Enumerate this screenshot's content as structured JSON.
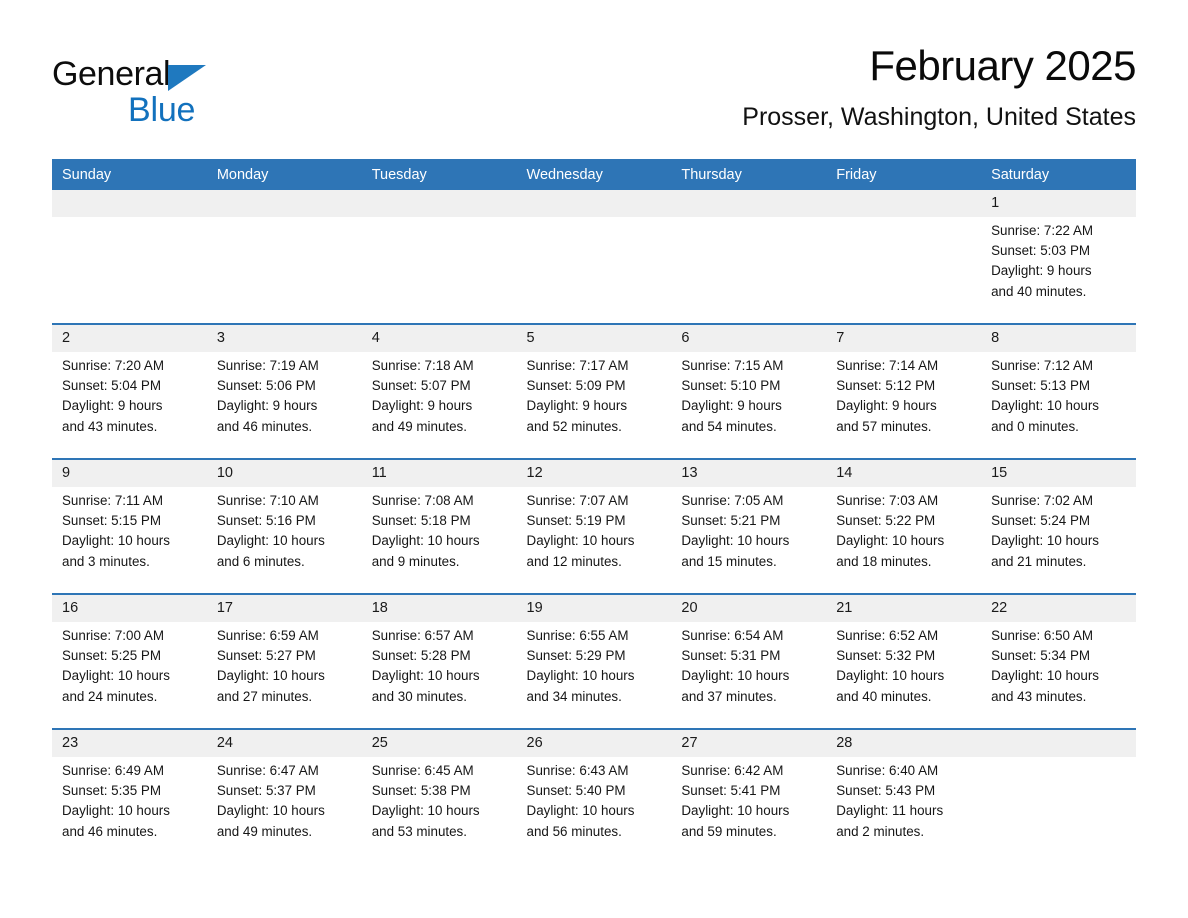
{
  "brand": {
    "name_dark": "General",
    "name_blue": "Blue",
    "accent_color": "#1f79bf"
  },
  "header": {
    "month_title": "February 2025",
    "location": "Prosser, Washington, United States",
    "header_bg_color": "#2e75b6",
    "daynum_bg_color": "#f0f0f0"
  },
  "weekday_headers": [
    "Sunday",
    "Monday",
    "Tuesday",
    "Wednesday",
    "Thursday",
    "Friday",
    "Saturday"
  ],
  "weeks": [
    [
      {
        "day": "",
        "empty": true,
        "sunrise": "",
        "sunset": "",
        "daylight1": "",
        "daylight2": ""
      },
      {
        "day": "",
        "empty": true,
        "sunrise": "",
        "sunset": "",
        "daylight1": "",
        "daylight2": ""
      },
      {
        "day": "",
        "empty": true,
        "sunrise": "",
        "sunset": "",
        "daylight1": "",
        "daylight2": ""
      },
      {
        "day": "",
        "empty": true,
        "sunrise": "",
        "sunset": "",
        "daylight1": "",
        "daylight2": ""
      },
      {
        "day": "",
        "empty": true,
        "sunrise": "",
        "sunset": "",
        "daylight1": "",
        "daylight2": ""
      },
      {
        "day": "",
        "empty": true,
        "sunrise": "",
        "sunset": "",
        "daylight1": "",
        "daylight2": ""
      },
      {
        "day": "1",
        "empty": false,
        "sunrise": "Sunrise: 7:22 AM",
        "sunset": "Sunset: 5:03 PM",
        "daylight1": "Daylight: 9 hours",
        "daylight2": "and 40 minutes."
      }
    ],
    [
      {
        "day": "2",
        "empty": false,
        "sunrise": "Sunrise: 7:20 AM",
        "sunset": "Sunset: 5:04 PM",
        "daylight1": "Daylight: 9 hours",
        "daylight2": "and 43 minutes."
      },
      {
        "day": "3",
        "empty": false,
        "sunrise": "Sunrise: 7:19 AM",
        "sunset": "Sunset: 5:06 PM",
        "daylight1": "Daylight: 9 hours",
        "daylight2": "and 46 minutes."
      },
      {
        "day": "4",
        "empty": false,
        "sunrise": "Sunrise: 7:18 AM",
        "sunset": "Sunset: 5:07 PM",
        "daylight1": "Daylight: 9 hours",
        "daylight2": "and 49 minutes."
      },
      {
        "day": "5",
        "empty": false,
        "sunrise": "Sunrise: 7:17 AM",
        "sunset": "Sunset: 5:09 PM",
        "daylight1": "Daylight: 9 hours",
        "daylight2": "and 52 minutes."
      },
      {
        "day": "6",
        "empty": false,
        "sunrise": "Sunrise: 7:15 AM",
        "sunset": "Sunset: 5:10 PM",
        "daylight1": "Daylight: 9 hours",
        "daylight2": "and 54 minutes."
      },
      {
        "day": "7",
        "empty": false,
        "sunrise": "Sunrise: 7:14 AM",
        "sunset": "Sunset: 5:12 PM",
        "daylight1": "Daylight: 9 hours",
        "daylight2": "and 57 minutes."
      },
      {
        "day": "8",
        "empty": false,
        "sunrise": "Sunrise: 7:12 AM",
        "sunset": "Sunset: 5:13 PM",
        "daylight1": "Daylight: 10 hours",
        "daylight2": "and 0 minutes."
      }
    ],
    [
      {
        "day": "9",
        "empty": false,
        "sunrise": "Sunrise: 7:11 AM",
        "sunset": "Sunset: 5:15 PM",
        "daylight1": "Daylight: 10 hours",
        "daylight2": "and 3 minutes."
      },
      {
        "day": "10",
        "empty": false,
        "sunrise": "Sunrise: 7:10 AM",
        "sunset": "Sunset: 5:16 PM",
        "daylight1": "Daylight: 10 hours",
        "daylight2": "and 6 minutes."
      },
      {
        "day": "11",
        "empty": false,
        "sunrise": "Sunrise: 7:08 AM",
        "sunset": "Sunset: 5:18 PM",
        "daylight1": "Daylight: 10 hours",
        "daylight2": "and 9 minutes."
      },
      {
        "day": "12",
        "empty": false,
        "sunrise": "Sunrise: 7:07 AM",
        "sunset": "Sunset: 5:19 PM",
        "daylight1": "Daylight: 10 hours",
        "daylight2": "and 12 minutes."
      },
      {
        "day": "13",
        "empty": false,
        "sunrise": "Sunrise: 7:05 AM",
        "sunset": "Sunset: 5:21 PM",
        "daylight1": "Daylight: 10 hours",
        "daylight2": "and 15 minutes."
      },
      {
        "day": "14",
        "empty": false,
        "sunrise": "Sunrise: 7:03 AM",
        "sunset": "Sunset: 5:22 PM",
        "daylight1": "Daylight: 10 hours",
        "daylight2": "and 18 minutes."
      },
      {
        "day": "15",
        "empty": false,
        "sunrise": "Sunrise: 7:02 AM",
        "sunset": "Sunset: 5:24 PM",
        "daylight1": "Daylight: 10 hours",
        "daylight2": "and 21 minutes."
      }
    ],
    [
      {
        "day": "16",
        "empty": false,
        "sunrise": "Sunrise: 7:00 AM",
        "sunset": "Sunset: 5:25 PM",
        "daylight1": "Daylight: 10 hours",
        "daylight2": "and 24 minutes."
      },
      {
        "day": "17",
        "empty": false,
        "sunrise": "Sunrise: 6:59 AM",
        "sunset": "Sunset: 5:27 PM",
        "daylight1": "Daylight: 10 hours",
        "daylight2": "and 27 minutes."
      },
      {
        "day": "18",
        "empty": false,
        "sunrise": "Sunrise: 6:57 AM",
        "sunset": "Sunset: 5:28 PM",
        "daylight1": "Daylight: 10 hours",
        "daylight2": "and 30 minutes."
      },
      {
        "day": "19",
        "empty": false,
        "sunrise": "Sunrise: 6:55 AM",
        "sunset": "Sunset: 5:29 PM",
        "daylight1": "Daylight: 10 hours",
        "daylight2": "and 34 minutes."
      },
      {
        "day": "20",
        "empty": false,
        "sunrise": "Sunrise: 6:54 AM",
        "sunset": "Sunset: 5:31 PM",
        "daylight1": "Daylight: 10 hours",
        "daylight2": "and 37 minutes."
      },
      {
        "day": "21",
        "empty": false,
        "sunrise": "Sunrise: 6:52 AM",
        "sunset": "Sunset: 5:32 PM",
        "daylight1": "Daylight: 10 hours",
        "daylight2": "and 40 minutes."
      },
      {
        "day": "22",
        "empty": false,
        "sunrise": "Sunrise: 6:50 AM",
        "sunset": "Sunset: 5:34 PM",
        "daylight1": "Daylight: 10 hours",
        "daylight2": "and 43 minutes."
      }
    ],
    [
      {
        "day": "23",
        "empty": false,
        "sunrise": "Sunrise: 6:49 AM",
        "sunset": "Sunset: 5:35 PM",
        "daylight1": "Daylight: 10 hours",
        "daylight2": "and 46 minutes."
      },
      {
        "day": "24",
        "empty": false,
        "sunrise": "Sunrise: 6:47 AM",
        "sunset": "Sunset: 5:37 PM",
        "daylight1": "Daylight: 10 hours",
        "daylight2": "and 49 minutes."
      },
      {
        "day": "25",
        "empty": false,
        "sunrise": "Sunrise: 6:45 AM",
        "sunset": "Sunset: 5:38 PM",
        "daylight1": "Daylight: 10 hours",
        "daylight2": "and 53 minutes."
      },
      {
        "day": "26",
        "empty": false,
        "sunrise": "Sunrise: 6:43 AM",
        "sunset": "Sunset: 5:40 PM",
        "daylight1": "Daylight: 10 hours",
        "daylight2": "and 56 minutes."
      },
      {
        "day": "27",
        "empty": false,
        "sunrise": "Sunrise: 6:42 AM",
        "sunset": "Sunset: 5:41 PM",
        "daylight1": "Daylight: 10 hours",
        "daylight2": "and 59 minutes."
      },
      {
        "day": "28",
        "empty": false,
        "sunrise": "Sunrise: 6:40 AM",
        "sunset": "Sunset: 5:43 PM",
        "daylight1": "Daylight: 11 hours",
        "daylight2": "and 2 minutes."
      },
      {
        "day": "",
        "empty": true,
        "sunrise": "",
        "sunset": "",
        "daylight1": "",
        "daylight2": ""
      }
    ]
  ]
}
